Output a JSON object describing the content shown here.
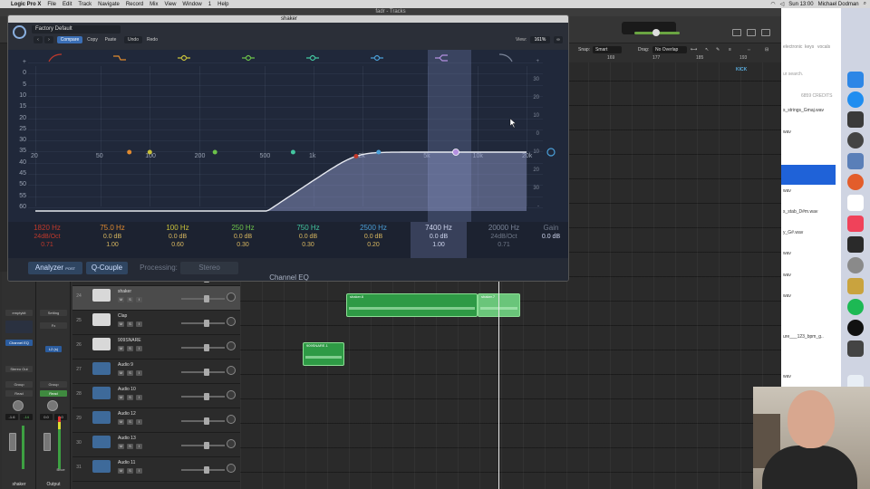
{
  "menubar": {
    "app": "Logic Pro X",
    "items": [
      "File",
      "Edit",
      "Track",
      "Navigate",
      "Record",
      "Mix",
      "View",
      "Window",
      "1",
      "Help"
    ],
    "clock": "Sun 13:00",
    "user": "Michael Dodman"
  },
  "window": {
    "title": "fadr - Tracks"
  },
  "tracks_header": {
    "snap_label": "Snap:",
    "snap_value": "Smart",
    "drag_label": "Drag:",
    "drag_value": "No Overlap",
    "ruler": [
      "169",
      "177",
      "185",
      "193"
    ],
    "marker": "KICK"
  },
  "eq": {
    "window_title": "shaker",
    "preset": "Factory Default",
    "buttons": {
      "compare": "Compare",
      "copy": "Copy",
      "paste": "Paste",
      "undo": "Undo",
      "redo": "Redo"
    },
    "view_label": "View:",
    "view_value": "161%",
    "db_scale_left": [
      "+",
      "0",
      "5",
      "10",
      "15",
      "20",
      "25",
      "30",
      "35",
      "40",
      "45",
      "50",
      "55",
      "60"
    ],
    "db_scale_right": [
      "+",
      "30",
      "20",
      "10",
      "0",
      "10",
      "20",
      "30",
      "-"
    ],
    "freq_labels": [
      "20",
      "50",
      "100",
      "200",
      "500",
      "1k",
      "2k",
      "5k",
      "10k",
      "20k"
    ],
    "bands": [
      {
        "freq": "1820 Hz",
        "gain": "24dB/Oct",
        "q": "0.71",
        "color": "#c0392b"
      },
      {
        "freq": "75.0 Hz",
        "gain": "0.0 dB",
        "q": "1.00",
        "color": "#e08a2f"
      },
      {
        "freq": "100 Hz",
        "gain": "0.0 dB",
        "q": "0.60",
        "color": "#c9c23a"
      },
      {
        "freq": "250 Hz",
        "gain": "0.0 dB",
        "q": "0.30",
        "color": "#6cc24a"
      },
      {
        "freq": "750 Hz",
        "gain": "0.0 dB",
        "q": "0.30",
        "color": "#43c6a0"
      },
      {
        "freq": "2500 Hz",
        "gain": "0.0 dB",
        "q": "0.20",
        "color": "#4a9fd8"
      },
      {
        "freq": "7400 Hz",
        "gain": "0.0 dB",
        "q": "1.00",
        "color": "#b490e0"
      },
      {
        "freq": "20000 Hz",
        "gain": "24dB/Oct",
        "q": "0.71",
        "color": "#7a8498"
      }
    ],
    "gain_label": "Gain",
    "gain_value": "0.0 dB",
    "footer": {
      "analyzer": "Analyzer",
      "analyzer_post": "POST",
      "qcouple": "Q-Couple",
      "processing_label": "Processing:",
      "processing_value": "Stereo"
    },
    "plugin_name": "Channel EQ"
  },
  "tracks": [
    {
      "num": "24",
      "name": "shaker",
      "type": "inst",
      "selected": true
    },
    {
      "num": "25",
      "name": "Clap",
      "type": "inst",
      "selected": false
    },
    {
      "num": "26",
      "name": "909SNARE",
      "type": "inst",
      "selected": false
    },
    {
      "num": "27",
      "name": "Audio 9",
      "type": "aud",
      "selected": false
    },
    {
      "num": "28",
      "name": "Audio 10",
      "type": "aud",
      "selected": false
    },
    {
      "num": "29",
      "name": "Audio 12",
      "type": "aud",
      "selected": false
    },
    {
      "num": "30",
      "name": "Audio 13",
      "type": "aud",
      "selected": false
    },
    {
      "num": "31",
      "name": "Audio 11",
      "type": "aud",
      "selected": false
    }
  ],
  "regions": [
    {
      "name": "shaker.6"
    },
    {
      "name": "shaker.7"
    },
    {
      "name": "909SNARE.1"
    }
  ],
  "mixer": {
    "strip1": {
      "instrument": "emptykit",
      "plugin": "Channel EQ",
      "output": "Stereo Out",
      "group": "Group",
      "auto": "Read",
      "val1": "-1.6",
      "val2": "-14",
      "name": "shaker"
    },
    "strip2": {
      "setting": "Setting",
      "fx": "Fx",
      "slot": "L2 (s)",
      "group": "Group",
      "auto": "Read",
      "val1": "0.0",
      "val2": "0.0",
      "bnce": "Bnce",
      "name": "Output"
    }
  },
  "browser": {
    "credits": "6859 CREDITS",
    "search_hint": "ur search.",
    "tags": [
      "electronic",
      "keys",
      "vocals"
    ],
    "files": [
      "s_strings_Gmaj.wav",
      "wav",
      "wav",
      "s_stab_D#m.wav",
      "y_G#.wav",
      "wav",
      "wav",
      "wav",
      "ure___123_bpm_g..",
      "wav"
    ]
  }
}
